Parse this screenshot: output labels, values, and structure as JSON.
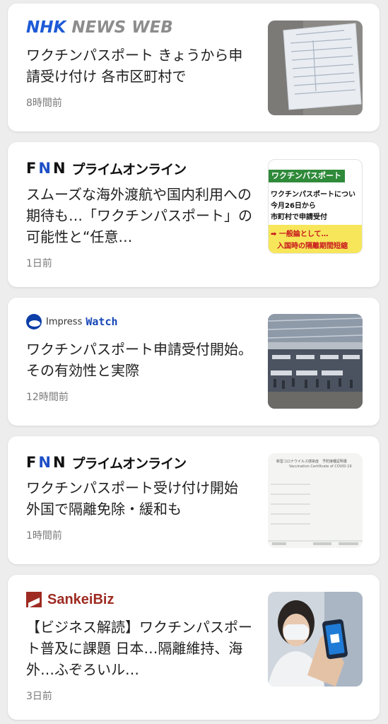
{
  "articles": [
    {
      "source": {
        "name_a": "NHK",
        "name_b": "NEWS WEB"
      },
      "headline": "ワクチンパスポート きょうから申請受け付け 各市区町村で",
      "time": "8時間前",
      "thumb": "document-photo"
    },
    {
      "source": {
        "name_f": "F",
        "name_n1": "N",
        "name_n2": "N",
        "name_sub": "プライムオンライン"
      },
      "headline": "スムーズな海外渡航や国内利用への期待も…「ワクチンパスポート」の可能性と“任意…",
      "time": "1日前",
      "thumb": {
        "banner": "ワクチンパスポート",
        "line1": "ワクチンパスポートについ",
        "line2": "今月26日から",
        "line3": "市町村で申請受付",
        "line4": "➡ 一般論として…",
        "line5": "入国時の隔離期間短縮"
      }
    },
    {
      "source": {
        "name_a": "Impress",
        "name_b": "Watch"
      },
      "headline": "ワクチンパスポート申請受付開始。その有効性と実際",
      "time": "12時間前",
      "thumb": "airport-photo"
    },
    {
      "source": {
        "name_f": "F",
        "name_n1": "N",
        "name_n2": "N",
        "name_sub": "プライムオンライン"
      },
      "headline": "ワクチンパスポート受け付け開始 外国で隔離免除・緩和も",
      "time": "1時間前",
      "thumb": {
        "title_jp": "新型コロナウイルス感染症　予防接種証明書",
        "title_en": "Vaccination Certificate of COVID-19"
      }
    },
    {
      "source": {
        "name": "SankeiBiz"
      },
      "headline": "【ビジネス解読】ワクチンパスポート普及に課題 日本…隔離維持、海外…ふぞろいル…",
      "time": "3日前",
      "thumb": "person-with-phone-photo"
    }
  ]
}
